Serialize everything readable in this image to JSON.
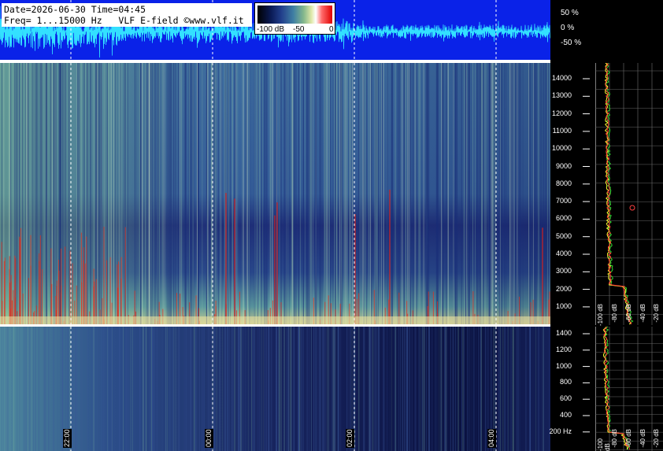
{
  "header": {
    "line1": "Date=2026-06-30 Time=04:45",
    "line2": "Freq= 1...15000 Hz   VLF E-field ©www.vlf.it"
  },
  "colorbar": {
    "labels": [
      "-100 dB",
      "-50",
      "0"
    ]
  },
  "amplitude_scale": [
    "50 %",
    "0 %",
    "-50 %"
  ],
  "upper_freq_ticks": [
    "14000",
    "13000",
    "12000",
    "11000",
    "10000",
    "9000",
    "8000",
    "7000",
    "6000",
    "5000",
    "4000",
    "3000",
    "2000",
    "1000"
  ],
  "lower_freq_ticks": [
    "1400",
    "1200",
    "1000",
    "800",
    "600",
    "400",
    "200 Hz"
  ],
  "time_labels": [
    "22:00",
    "00:00",
    "02:00",
    "04:00"
  ],
  "db_labels_upper": [
    "-100 dB",
    "-80 dB",
    "-60 dB",
    "-40 dB",
    "-20 dB"
  ],
  "db_labels_lower": [
    "-100 dB",
    "-80 dB",
    "-60 dB",
    "-40 dB",
    "-20 dB"
  ],
  "colors": {
    "background": "#000000",
    "waveform_bg": "#0a22e8",
    "waveform": "#33e0ff",
    "grid": "#ffffff"
  }
}
